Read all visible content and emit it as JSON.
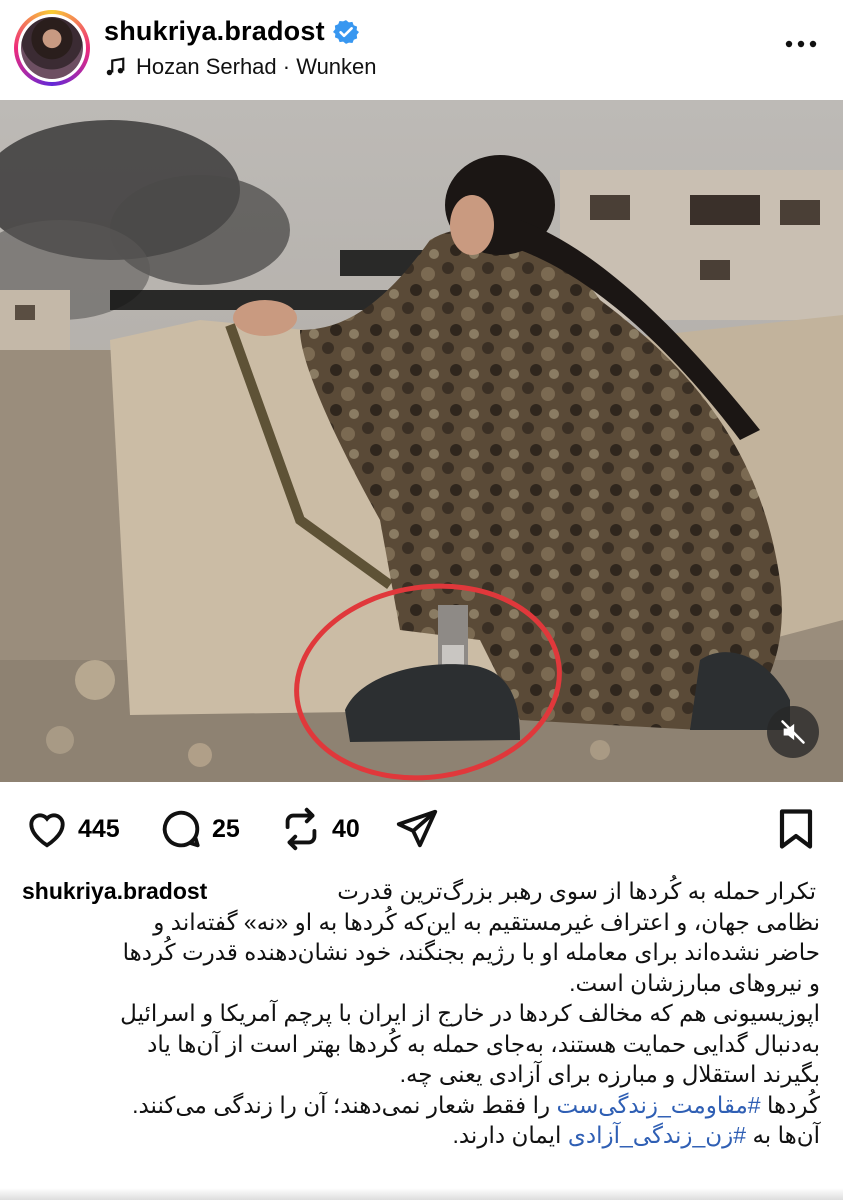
{
  "header": {
    "username": "shukriya.bradost",
    "music": "Hozan Serhad · Wunken"
  },
  "actions": {
    "likes": "445",
    "comments": "25",
    "reposts": "40"
  },
  "caption": {
    "username": "shukriya.bradost",
    "lines": [
      "تکرار حمله به کُردها از سوی رهبر بزرگ‌ترین قدرت",
      "نظامی جهان، و اعتراف غیرمستقیم به این‌که کُردها به او «نه» گفته‌اند و",
      "حاضر نشده‌اند برای معامله او با رژیم بجنگند، خود نشان‌دهنده قدرت کُردها",
      "و نیروهای مبارزشان است.",
      "اپوزیسیونی هم که مخالف کردها در خارج از ایران با پرچم آمریکا و اسرائیل",
      "به‌دنبال گدایی حمایت هستند، به‌جای حمله به کُردها بهتر است از آن‌ها یاد",
      "بگیرند استقلال و مبارزه برای آزادی یعنی چه."
    ],
    "hashtag_line_1": {
      "before": "کُردها ",
      "tag": "#مقاومت_زندگی‌ست",
      "after": " را فقط شعار نمی‌دهند؛ آن را زندگی می‌کنند."
    },
    "hashtag_line_2": {
      "before": "آن‌ها به ",
      "tag": "#زن_زندگی_آزادی",
      "after": " ایمان دارند."
    }
  },
  "icons": {
    "verified": "verified-badge-icon",
    "music": "music-note-icon",
    "more": "more-options-icon",
    "like": "heart-icon",
    "comment": "comment-icon",
    "repost": "repost-icon",
    "share": "send-icon",
    "save": "bookmark-icon",
    "mute": "speaker-muted-icon"
  },
  "colors": {
    "verified": "#3897f0",
    "hashtag": "#2f5fb4",
    "annotation_circle": "#e0383b"
  }
}
